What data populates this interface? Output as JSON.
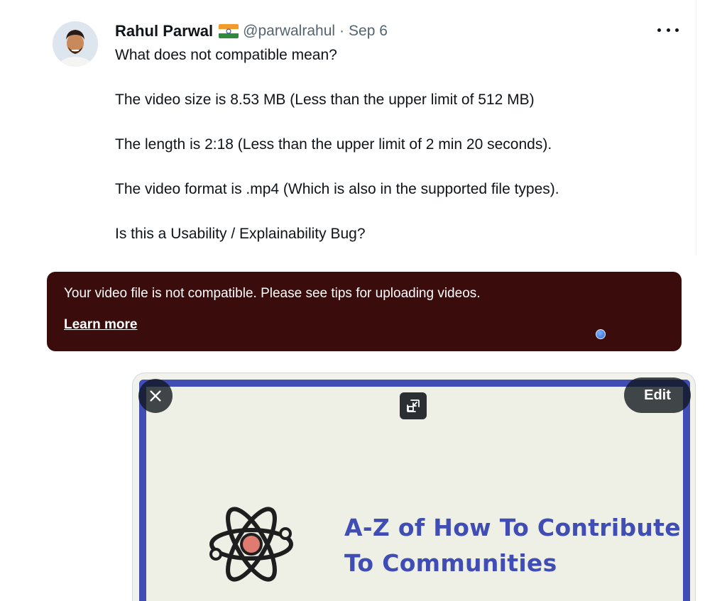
{
  "tweet": {
    "author_name": "Rahul Parwal",
    "handle": "@parwalrahul",
    "separator": "·",
    "date": "Sep 6",
    "lines": [
      "What does not compatible mean?",
      "The video size is 8.53 MB (Less than the upper limit of 512 MB)",
      "The length is 2:18 (Less than the upper limit of 2 min 20 seconds).",
      "The video format is .mp4 (Which is also in the supported file types).",
      "Is this a Usability / Explainability Bug?"
    ],
    "icons": {
      "avatar": "avatar-photo",
      "flag": "india-flag-emoji",
      "more": "more-options-icon"
    }
  },
  "error_banner": {
    "message": "Your video file is not compatible. Please see tips for uploading videos.",
    "link_label": "Learn more",
    "background_color": "#3a0c0c"
  },
  "media": {
    "edit_label": "Edit",
    "title_line1": "A-Z of How To Contribute",
    "title_line2": "To Communities",
    "accent_color": "#3f4db5",
    "icons": {
      "close": "close-icon",
      "resize": "resize-icon",
      "atom": "atom-icon"
    }
  }
}
